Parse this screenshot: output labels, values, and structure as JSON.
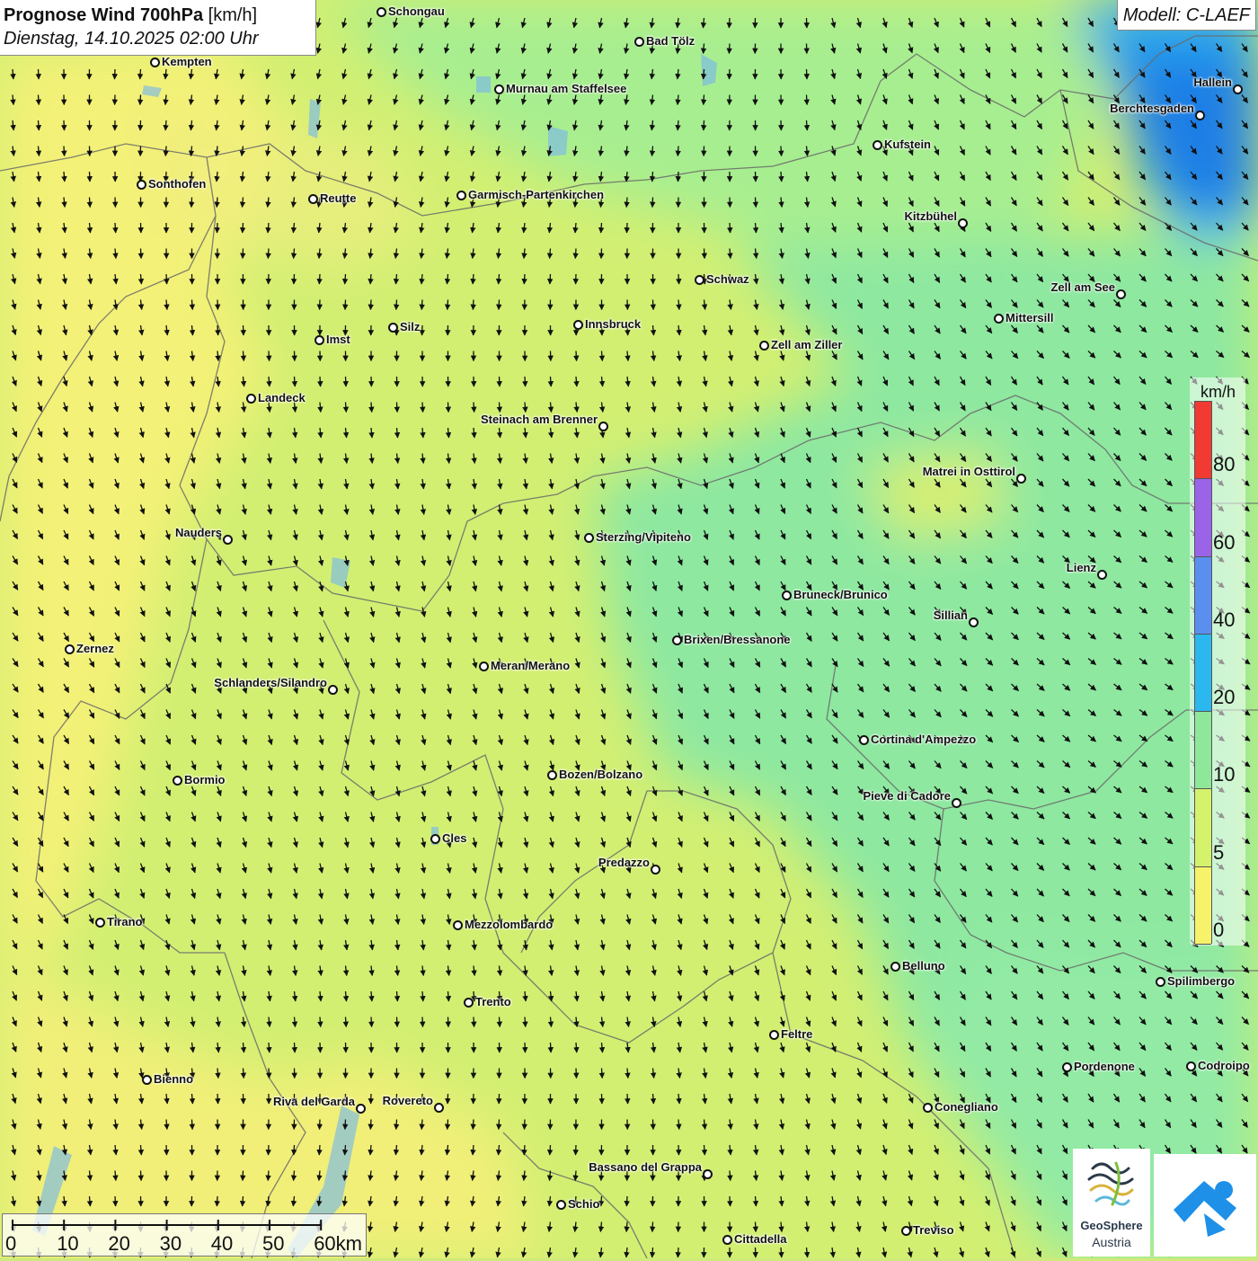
{
  "header": {
    "title_bold": "Prognose Wind 700hPa",
    "title_unit": "[km/h]",
    "subtitle": "Dienstag, 14.10.2025 02:00 Uhr"
  },
  "model": "Modell: C-LAEF",
  "legend": {
    "unit": "km/h",
    "classes": [
      {
        "label": "80",
        "color": "#f03a32"
      },
      {
        "label": "60",
        "color": "#9a63e8"
      },
      {
        "label": "40",
        "color": "#5a8ff0"
      },
      {
        "label": "20",
        "color": "#2bb8ee"
      },
      {
        "label": "10",
        "color": "#8fe899"
      },
      {
        "label": "5",
        "color": "#d4f26a"
      },
      {
        "label": "0",
        "color": "#f6f36a"
      }
    ]
  },
  "scalebar": {
    "labels": [
      "0",
      "10",
      "20",
      "30",
      "40",
      "50",
      "60km"
    ]
  },
  "cities": [
    {
      "name": "Schongau"
    },
    {
      "name": "Bad Tölz"
    },
    {
      "name": "Kempten"
    },
    {
      "name": "Murnau am Staffelsee"
    },
    {
      "name": "Hallein"
    },
    {
      "name": "Berchtesgaden"
    },
    {
      "name": "Kufstein"
    },
    {
      "name": "Sonthofen"
    },
    {
      "name": "Reutte"
    },
    {
      "name": "Garmisch-Partenkirchen"
    },
    {
      "name": "Kitzbühel"
    },
    {
      "name": "Schwaz"
    },
    {
      "name": "Zell am See"
    },
    {
      "name": "Mittersill"
    },
    {
      "name": "Innsbruck"
    },
    {
      "name": "Silz"
    },
    {
      "name": "Imst"
    },
    {
      "name": "Zell am Ziller"
    },
    {
      "name": "Landeck"
    },
    {
      "name": "Steinach am Brenner"
    },
    {
      "name": "Matrei in Osttirol"
    },
    {
      "name": "Nauders"
    },
    {
      "name": "Sterzing/Vipiteno"
    },
    {
      "name": "Lienz"
    },
    {
      "name": "Bruneck/Brunico"
    },
    {
      "name": "Sillian"
    },
    {
      "name": "Brixen/Bressanone"
    },
    {
      "name": "Zernez"
    },
    {
      "name": "Meran/Merano"
    },
    {
      "name": "Schlanders/Silandro"
    },
    {
      "name": "Cortina d'Ampezzo"
    },
    {
      "name": "Bozen/Bolzano"
    },
    {
      "name": "Bormio"
    },
    {
      "name": "Pieve di Cadore"
    },
    {
      "name": "Cles"
    },
    {
      "name": "Predazzo"
    },
    {
      "name": "Tirano"
    },
    {
      "name": "Mezzolombardo"
    },
    {
      "name": "Belluno"
    },
    {
      "name": "Spilimbergo"
    },
    {
      "name": "Trento"
    },
    {
      "name": "Feltre"
    },
    {
      "name": "Pordenone"
    },
    {
      "name": "Codroipo"
    },
    {
      "name": "Bienno"
    },
    {
      "name": "Riva del Garda"
    },
    {
      "name": "Rovereto"
    },
    {
      "name": "Conegliano"
    },
    {
      "name": "Bassano del Grappa"
    },
    {
      "name": "Schio"
    },
    {
      "name": "Treviso"
    },
    {
      "name": "Cittadella"
    }
  ],
  "logos": {
    "geosphere_line1": "GeoSphere",
    "geosphere_line2": "Austria"
  },
  "field_colors": {
    "calm": "#f3f177",
    "low": "#d2ef72",
    "mid": "#a7ee90",
    "higher": "#8ee8a0",
    "strong": "#2aa8f0",
    "strongest": "#1f7ee6"
  }
}
